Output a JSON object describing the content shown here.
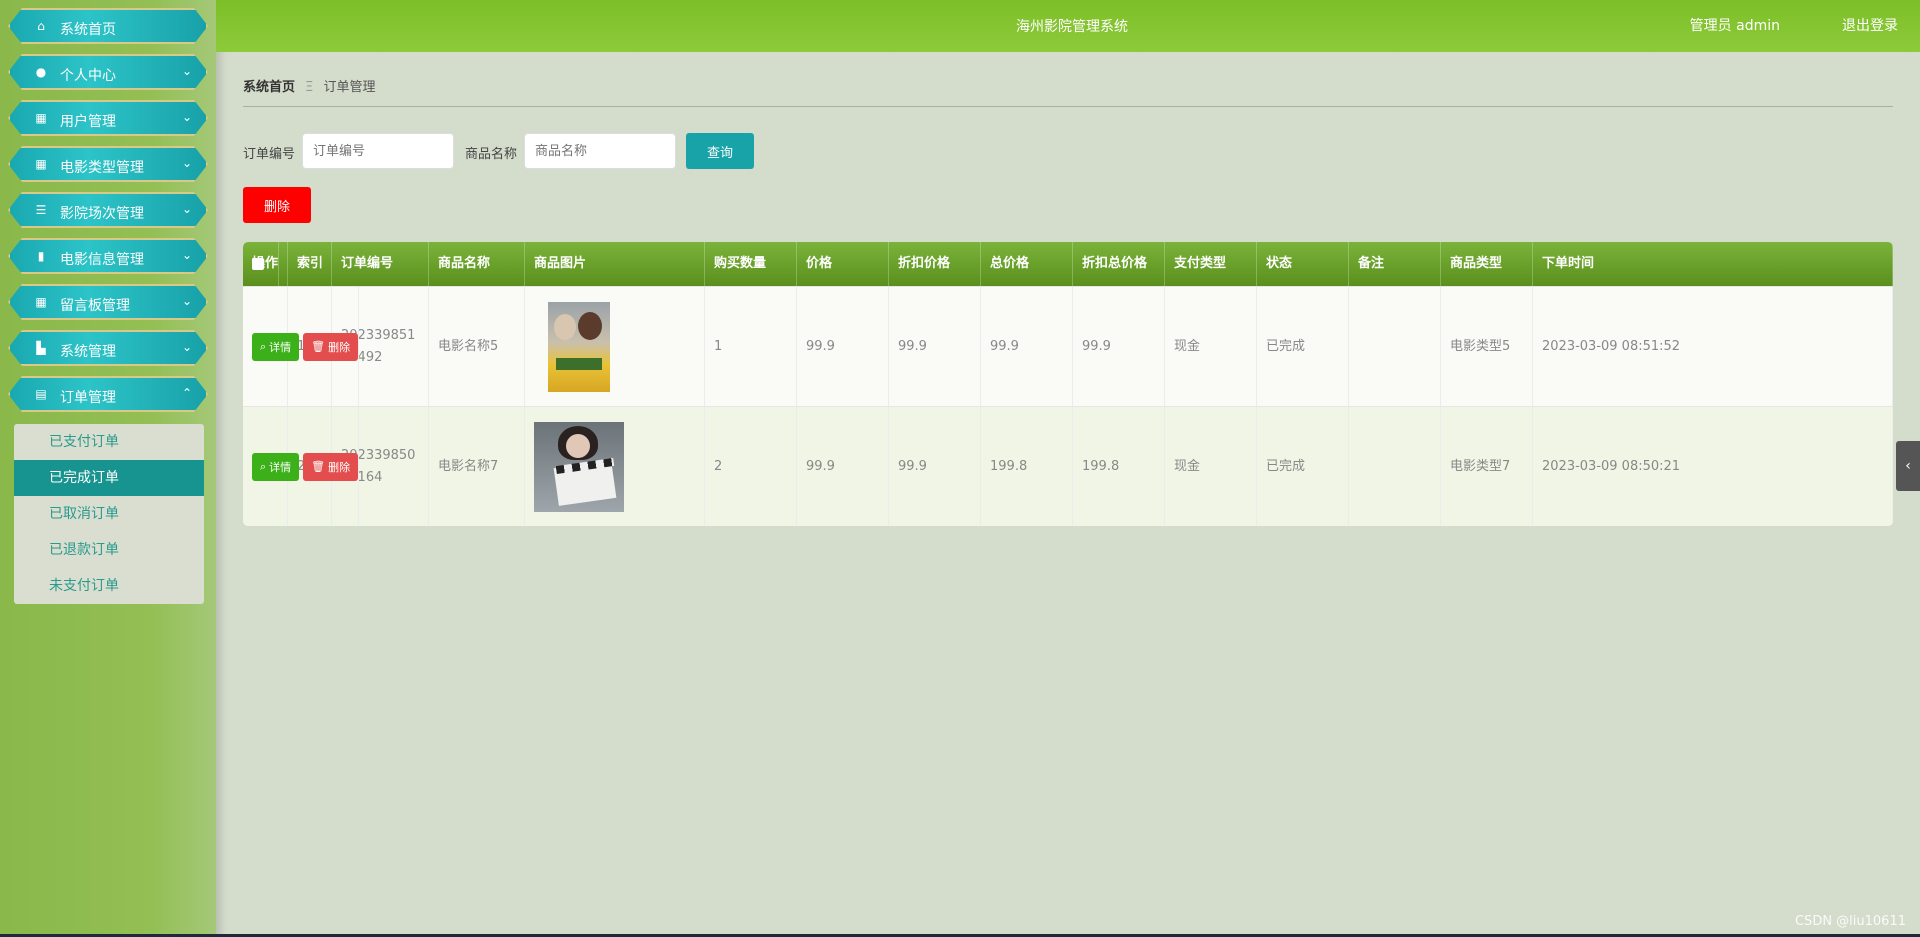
{
  "sidebar": {
    "items": [
      {
        "label": "系统首页",
        "icon": "home-icon",
        "glyph": "⌂",
        "chev": ""
      },
      {
        "label": "个人中心",
        "icon": "user-icon",
        "glyph": "●",
        "chev": "⌄"
      },
      {
        "label": "用户管理",
        "icon": "grid-icon",
        "glyph": "▦",
        "chev": "⌄"
      },
      {
        "label": "电影类型管理",
        "icon": "grid-icon",
        "glyph": "▦",
        "chev": "⌄"
      },
      {
        "label": "影院场次管理",
        "icon": "sliders-icon",
        "glyph": "☰",
        "chev": "⌄"
      },
      {
        "label": "电影信息管理",
        "icon": "chart-icon",
        "glyph": "▮",
        "chev": "⌄"
      },
      {
        "label": "留言板管理",
        "icon": "grid-icon",
        "glyph": "▦",
        "chev": "⌄"
      },
      {
        "label": "系统管理",
        "icon": "building-icon",
        "glyph": "▙",
        "chev": "⌄"
      },
      {
        "label": "订单管理",
        "icon": "clipboard-icon",
        "glyph": "▤",
        "chev": "⌃"
      }
    ],
    "submenu": [
      {
        "label": "已支付订单",
        "active": false
      },
      {
        "label": "已完成订单",
        "active": true
      },
      {
        "label": "已取消订单",
        "active": false
      },
      {
        "label": "已退款订单",
        "active": false
      },
      {
        "label": "未支付订单",
        "active": false
      }
    ]
  },
  "header": {
    "title": "海州影院管理系统",
    "user": "管理员 admin",
    "logout": "退出登录"
  },
  "breadcrumb": {
    "home": "系统首页",
    "separator": "Ξ",
    "current": "订单管理"
  },
  "search": {
    "order_no_label": "订单编号",
    "order_no_placeholder": "订单编号",
    "product_name_label": "商品名称",
    "product_name_placeholder": "商品名称",
    "query_button": "查询",
    "delete_button": "删除"
  },
  "table": {
    "columns": [
      "索引",
      "订单编号",
      "商品名称",
      "商品图片",
      "购买数量",
      "价格",
      "折扣价格",
      "总价格",
      "折扣总价格",
      "支付类型",
      "状态",
      "备注",
      "商品类型",
      "下单时间",
      "操作"
    ],
    "rows": [
      {
        "index": "1",
        "order_no": "20233985145492",
        "name": "电影名称5",
        "qty": "1",
        "price": "99.9",
        "discount_price": "99.9",
        "total": "99.9",
        "discount_total": "99.9",
        "pay_type": "现金",
        "status": "已完成",
        "remark": "",
        "type": "电影类型5",
        "time": "2023-03-09 08:51:52",
        "poster": "poster-1"
      },
      {
        "index": "2",
        "order_no": "20233985015164",
        "name": "电影名称7",
        "qty": "2",
        "price": "99.9",
        "discount_price": "99.9",
        "total": "199.8",
        "discount_total": "199.8",
        "pay_type": "现金",
        "status": "已完成",
        "remark": "",
        "type": "电影类型7",
        "time": "2023-03-09 08:50:21",
        "poster": "poster-2"
      }
    ],
    "detail_button": "详情",
    "delete_button": "删除"
  },
  "watermark": "CSDN @liu10611",
  "colors": {
    "header": "#7cbf28",
    "menu": "#1aa8b0",
    "query": "#17a3a8",
    "danger": "#ff0000",
    "detail": "#3cb019",
    "remove": "#e34d4d"
  }
}
